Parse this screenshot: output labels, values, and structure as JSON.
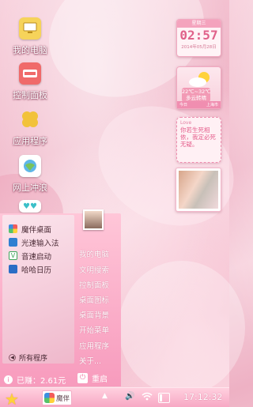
{
  "desktop_icons": [
    {
      "label": "我的电脑",
      "icon": "computer-icon",
      "color": "#f6d35a"
    },
    {
      "label": "控制面板",
      "icon": "control-panel-icon",
      "color": "#f06a6a"
    },
    {
      "label": "应用程序",
      "icon": "clover-icon",
      "color": "#f2c23b"
    },
    {
      "label": "网上冲浪",
      "icon": "globe-icon",
      "color": "#5fb7e8"
    }
  ],
  "widgets": {
    "clock": {
      "header": "星期三",
      "time": "02:57",
      "date": "2014年05月28日"
    },
    "weather": {
      "temp": "22℃~32℃",
      "desc": "多云转晴",
      "today": "今日",
      "city": "上海市"
    },
    "note": {
      "title": "Love",
      "text": "你若生死相依，我定必死无疑。"
    }
  },
  "start_menu": {
    "apps": [
      {
        "label": "魔伴桌面",
        "icon": "moban-icon",
        "color": "#e94a6a"
      },
      {
        "label": "光速输入法",
        "icon": "input-method-icon",
        "color": "#2f7fd1"
      },
      {
        "label": "音速启动",
        "icon": "launcher-icon",
        "color": "#3da55a"
      },
      {
        "label": "哈哈日历",
        "icon": "calendar-icon",
        "color": "#2a6dc5"
      }
    ],
    "all_programs": "所有程序",
    "links": [
      "我的电脑",
      "文明搜索",
      "控制面板",
      "桌面图标",
      "桌面背景",
      "开始菜单",
      "应用程序",
      "关于..."
    ],
    "earned_label": "已赚：2.61元",
    "restart_label": "重启"
  },
  "taskbar": {
    "task_label": "魔伴",
    "clock": "17:12:32",
    "battery_level": 0.25
  }
}
